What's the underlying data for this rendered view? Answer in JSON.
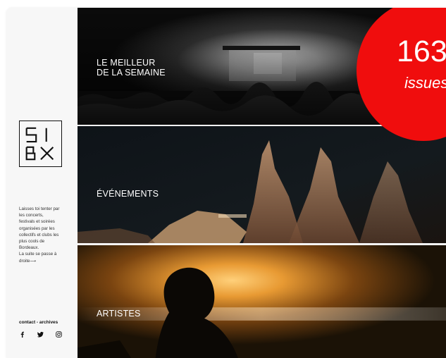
{
  "logo": {
    "text": "SIBX",
    "icon": "sibx-logo"
  },
  "sidebar": {
    "tagline_lines": [
      "Laisses toi tenter par",
      "les concerts,",
      "festivals et soirées",
      "organisées par les",
      "collectifs et clubs les",
      "plus cools de",
      "Bordeaux."
    ],
    "cta_line1": "La suite se passe à",
    "cta_line2": "droite",
    "cta_arrow": "⟶",
    "contact_label": "contact",
    "separator": " - ",
    "archives_label": "archives",
    "social": [
      "facebook-icon",
      "twitter-icon",
      "instagram-icon"
    ]
  },
  "panels": [
    {
      "line1": "LE MEILLEUR",
      "line2": "DE LA SEMAINE"
    },
    {
      "line1": "ÉVÉNEMENTS"
    },
    {
      "line1": "ARTISTES"
    }
  ],
  "badge": {
    "count": "163",
    "label": "issues",
    "color": "#f00d0d"
  }
}
